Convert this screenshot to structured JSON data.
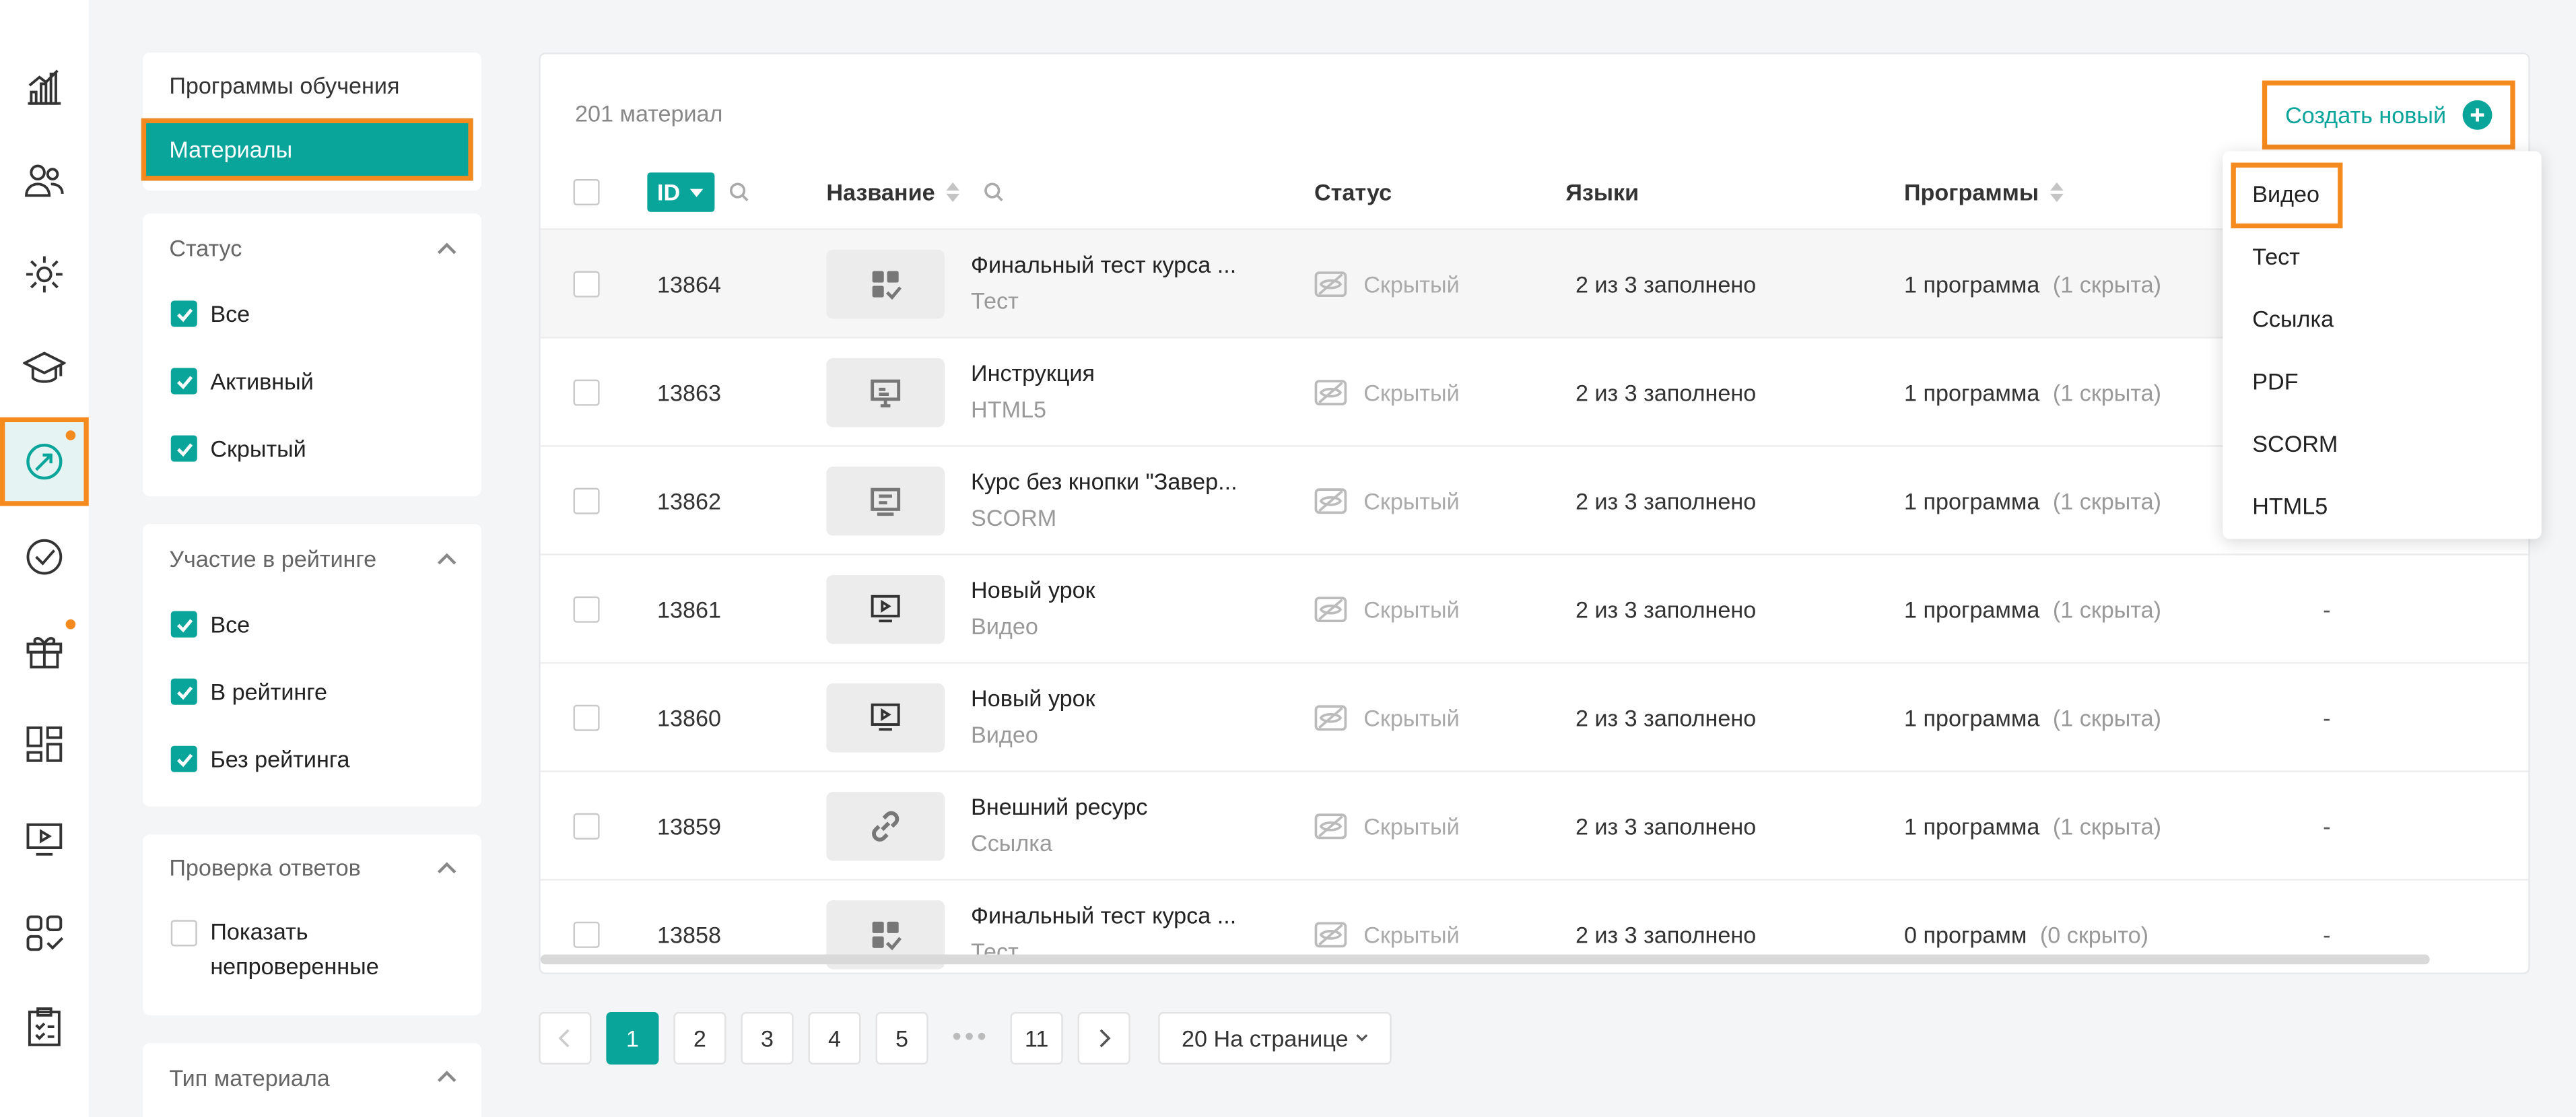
{
  "colors": {
    "accent": "#0aa59a",
    "highlight": "#f58a1f"
  },
  "rail": {
    "icons": [
      "analytics-icon",
      "users-icon",
      "gear-icon",
      "graduation-cap-icon",
      "course-materials-icon",
      "check-circle-icon",
      "gift-icon",
      "dashboard-icon",
      "video-icon",
      "apps-icon",
      "clipboard-icon"
    ]
  },
  "sidebar": {
    "nav": {
      "programs": "Программы обучения",
      "materials": "Материалы"
    },
    "filters": [
      {
        "title": "Статус",
        "options": [
          {
            "label": "Все",
            "checked": true
          },
          {
            "label": "Активный",
            "checked": true
          },
          {
            "label": "Скрытый",
            "checked": true
          }
        ]
      },
      {
        "title": "Участие в рейтинге",
        "options": [
          {
            "label": "Все",
            "checked": true
          },
          {
            "label": "В рейтинге",
            "checked": true
          },
          {
            "label": "Без рейтинга",
            "checked": true
          }
        ]
      },
      {
        "title": "Проверка ответов",
        "options": [
          {
            "label_line1": "Показать",
            "label_line2": "непроверенные",
            "checked": false
          }
        ]
      },
      {
        "title": "Тип материала"
      }
    ]
  },
  "main": {
    "count": "201 материал",
    "create_label": "Создать новый",
    "columns": {
      "id": "ID",
      "name": "Название",
      "status": "Статус",
      "languages": "Языки",
      "programs": "Программы"
    },
    "rows": [
      {
        "id": "13864",
        "title": "Финальный тест курса ...",
        "type": "Тест",
        "icon": "quiz-icon",
        "status": "Скрытый",
        "languages": "2 из 3 заполнено",
        "programs": "1 программа",
        "programs_hidden": "(1 скрыта)",
        "extra": ""
      },
      {
        "id": "13863",
        "title": "Инструкция",
        "type": "HTML5",
        "icon": "presentation-icon",
        "status": "Скрытый",
        "languages": "2 из 3 заполнено",
        "programs": "1 программа",
        "programs_hidden": "(1 скрыта)",
        "extra": ""
      },
      {
        "id": "13862",
        "title": "Курс без кнопки \"Завер...",
        "type": "SCORM",
        "icon": "document-icon",
        "status": "Скрытый",
        "languages": "2 из 3 заполнено",
        "programs": "1 программа",
        "programs_hidden": "(1 скрыта)",
        "extra": ""
      },
      {
        "id": "13861",
        "title": "Новый урок",
        "type": "Видео",
        "icon": "video-icon",
        "status": "Скрытый",
        "languages": "2 из 3 заполнено",
        "programs": "1 программа",
        "programs_hidden": "(1 скрыта)",
        "extra": "-"
      },
      {
        "id": "13860",
        "title": "Новый урок",
        "type": "Видео",
        "icon": "video-icon",
        "status": "Скрытый",
        "languages": "2 из 3 заполнено",
        "programs": "1 программа",
        "programs_hidden": "(1 скрыта)",
        "extra": "-"
      },
      {
        "id": "13859",
        "title": "Внешний ресурс",
        "type": "Ссылка",
        "icon": "link-icon",
        "status": "Скрытый",
        "languages": "2 из 3 заполнено",
        "programs": "1 программа",
        "programs_hidden": "(1 скрыта)",
        "extra": "-"
      },
      {
        "id": "13858",
        "title": "Финальный тест курса ...",
        "type": "Тест",
        "icon": "quiz-icon",
        "status": "Скрытый",
        "languages": "2 из 3 заполнено",
        "programs": "0 программ",
        "programs_hidden": "(0 скрыто)",
        "extra": "-"
      }
    ]
  },
  "dropdown": {
    "items": [
      "Видео",
      "Тест",
      "Ссылка",
      "PDF",
      "SCORM",
      "HTML5"
    ],
    "selected": "Видео"
  },
  "pagination": {
    "pages": [
      "1",
      "2",
      "3",
      "4",
      "5"
    ],
    "dots": "•••",
    "last": "11",
    "current": "1",
    "per_page": "20 На странице"
  }
}
